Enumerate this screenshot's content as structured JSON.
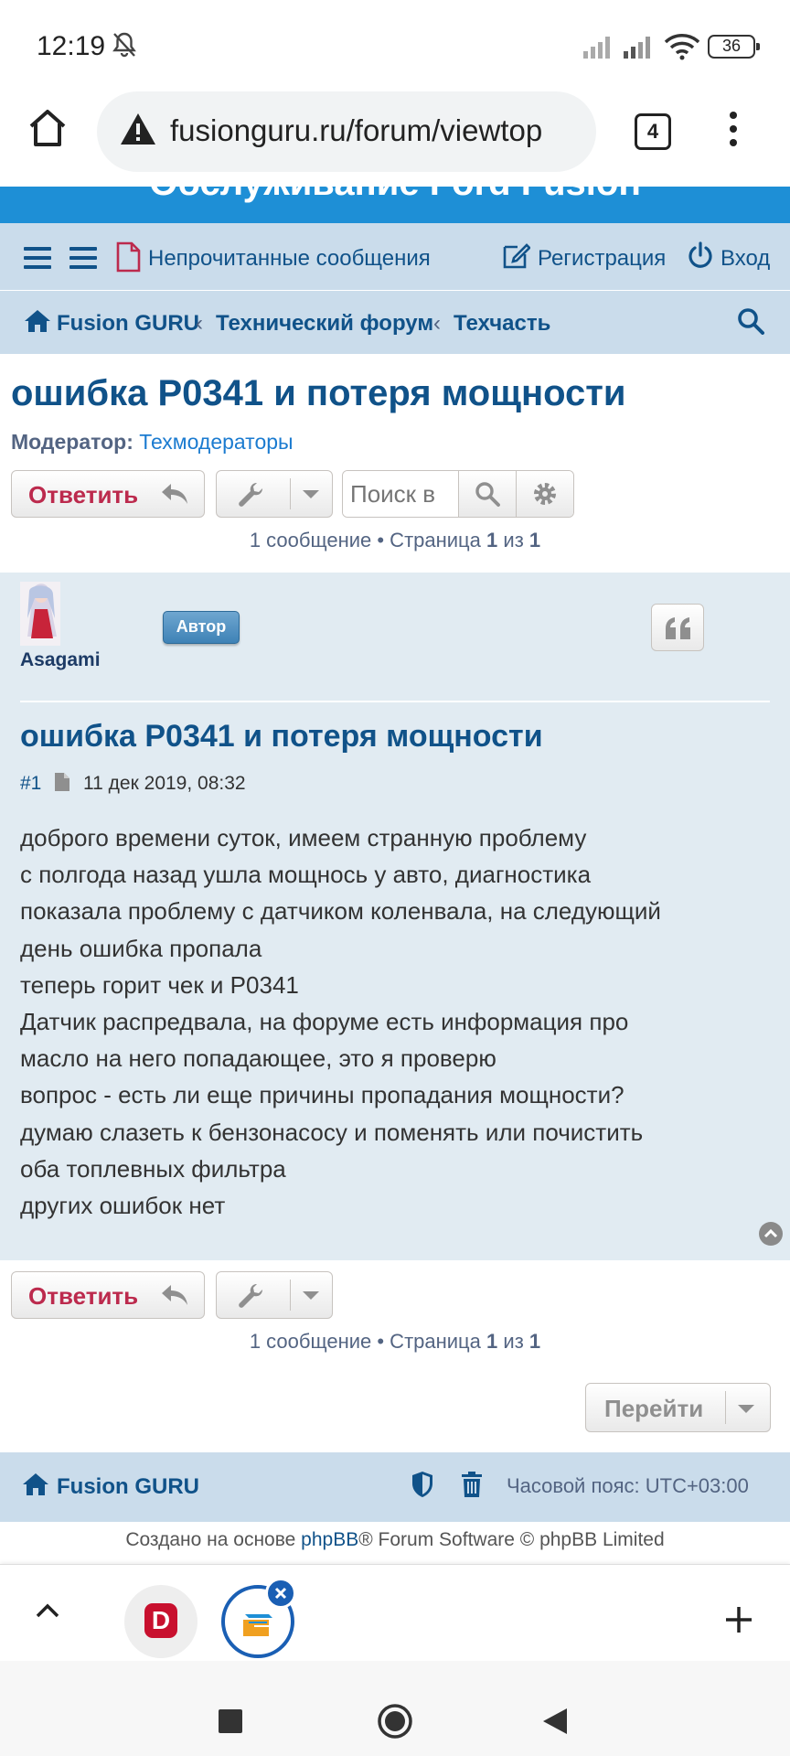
{
  "status_bar": {
    "time": "12:19",
    "battery": "36"
  },
  "browser": {
    "url": "fusionguru.ru/forum/viewtop",
    "tab_count": "4"
  },
  "site": {
    "header_title": "Обслуживание Ford Fusion"
  },
  "nav": {
    "unread": "Непрочитанные сообщения",
    "register": "Регистрация",
    "login": "Вход",
    "breadcrumbs": [
      "Fusion GURU",
      "Технический форум",
      "Техчасть"
    ]
  },
  "topic": {
    "title": "ошибка P0341 и потеря мощности",
    "moderator_label": "Модератор:",
    "moderator_value": "Техмодераторы",
    "reply_label": "Ответить",
    "search_placeholder": "Поиск в",
    "pagination": {
      "count_text": "1 сообщение • Страница",
      "page": "1",
      "of": "из",
      "total": "1"
    }
  },
  "post": {
    "username": "Asagami",
    "badge": "Автор",
    "title": "ошибка P0341 и потеря мощности",
    "number": "#1",
    "date": "11 дек 2019, 08:32",
    "body_lines": [
      "доброго времени суток, имеем странную проблему",
      "с полгода назад ушла мощнось у авто, диагностика",
      "показала проблему с датчиком коленвала, на следующий",
      "день ошибка пропала",
      "теперь горит чек и P0341",
      "Датчик распредвала, на форуме есть информация про",
      "масло на него попадающее, это я проверю",
      "вопрос - есть ли еще причины пропадания мощности?",
      "думаю слазеть к бензонасосу и поменять или почистить",
      "оба топлевных фильтра",
      "других ошибок нет"
    ]
  },
  "jump": {
    "label": "Перейти"
  },
  "footer": {
    "brand": "Fusion GURU",
    "timezone": "Часовой пояс: UTC+03:00",
    "credits_pre": "Создано на основе",
    "credits_link": "phpBB",
    "credits_post": "® Forum Software © phpBB Limited"
  },
  "tabbar": {
    "tab_logo_letter": "D"
  },
  "colors": {
    "brand_blue": "#105289",
    "header_blue": "#1e8fd6",
    "nav_bg": "#cadceb",
    "post_bg": "#e1ebf2",
    "reply_red": "#bc2a4d"
  }
}
